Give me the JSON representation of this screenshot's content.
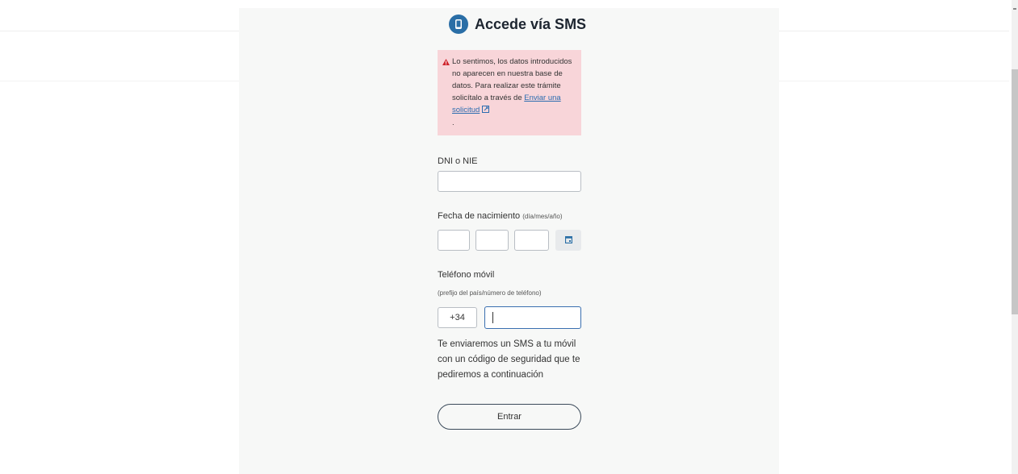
{
  "header": {
    "title": "Accede vía SMS",
    "icon": "phone-icon",
    "icon_color": "#2a6ea6"
  },
  "alert": {
    "icon": "warning-triangle-icon",
    "color": "#f8d5d9",
    "text_before_link": "Lo sentimos, los datos introducidos no aparecen en nuestra base de datos. Para realizar este trámite solicítalo a través de ",
    "link_text": "Enviar una solicitud",
    "link_icon": "external-link-icon",
    "text_after_link": "."
  },
  "dni": {
    "label": "DNI o NIE",
    "value": ""
  },
  "birthdate": {
    "label": "Fecha de nacimiento",
    "hint": "(día/mes/año)",
    "day": "",
    "month": "",
    "year": "",
    "calendar_icon": "calendar-icon"
  },
  "phone": {
    "label": "Teléfono móvil",
    "hint": "(prefijo del país/número de teléfono)",
    "prefix": "+34",
    "value": ""
  },
  "sms_info": "Te enviaremos un SMS a tu móvil con un código de seguridad que te pediremos a continuación",
  "submit": {
    "label": "Entrar"
  }
}
